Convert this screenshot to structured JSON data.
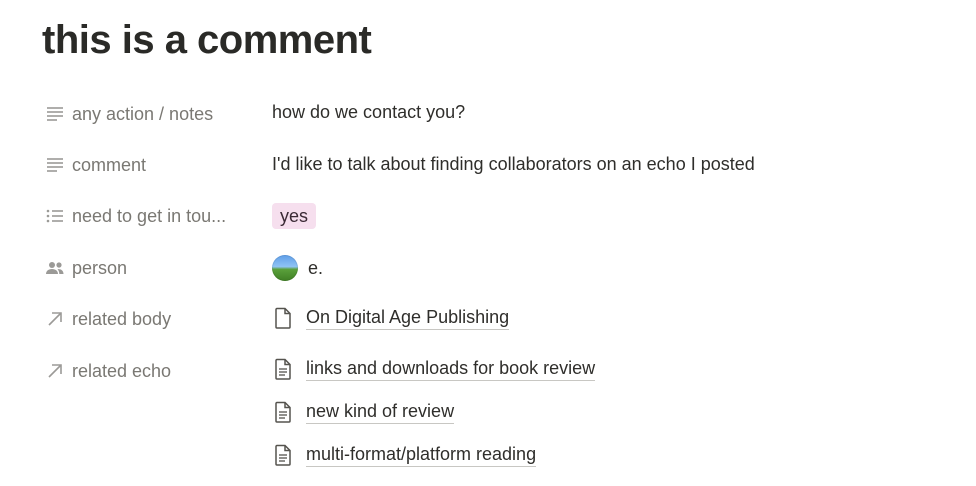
{
  "page": {
    "title": "this is a comment"
  },
  "properties": [
    {
      "label": "any action / notes",
      "icon": "text-lines-icon",
      "value": "how do we contact you?"
    },
    {
      "label": "comment",
      "icon": "text-lines-icon",
      "value": "I'd like to talk about finding collaborators on an echo I posted"
    },
    {
      "label": "need to get in tou...",
      "icon": "bulleted-list-icon",
      "tag": "yes",
      "tag_color": "#f6dfee"
    },
    {
      "label": "person",
      "icon": "people-icon",
      "person": "e."
    },
    {
      "label": "related body",
      "icon": "arrow-up-right-icon",
      "links": [
        "On Digital Age Publishing"
      ]
    },
    {
      "label": "related echo",
      "icon": "arrow-up-right-icon",
      "links": [
        "links and downloads for book review",
        "new kind of review",
        "multi-format/platform reading"
      ]
    }
  ]
}
